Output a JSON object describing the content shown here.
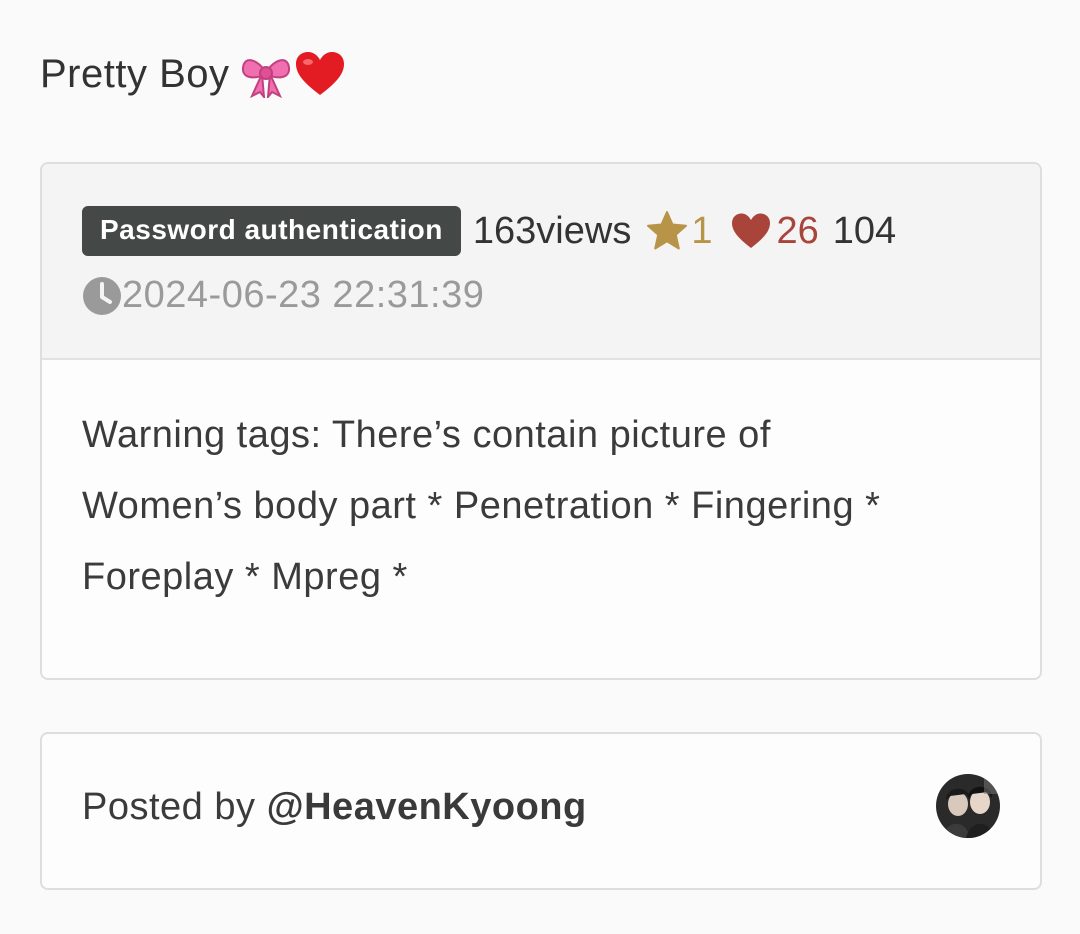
{
  "post": {
    "title": "Pretty Boy",
    "title_emojis": [
      "ribbon-emoji",
      "red-heart-emoji"
    ]
  },
  "meta": {
    "badge": "Password authentication",
    "views": "163views",
    "stars": "1",
    "hearts": "26",
    "comments": "104",
    "date": "2024-06-23 22:31:39",
    "colors": {
      "star": "#b89449",
      "heart": "#a9443b",
      "badge_bg": "#444846"
    }
  },
  "content": {
    "lines": [
      "Warning tags: There’s contain picture of",
      "Women’s body part * Penetration * Fingering *",
      "Foreplay * Mpreg *"
    ]
  },
  "author": {
    "prefix": "Posted by ",
    "handle": "@HeavenKyoong",
    "avatar_icon": "avatar"
  }
}
